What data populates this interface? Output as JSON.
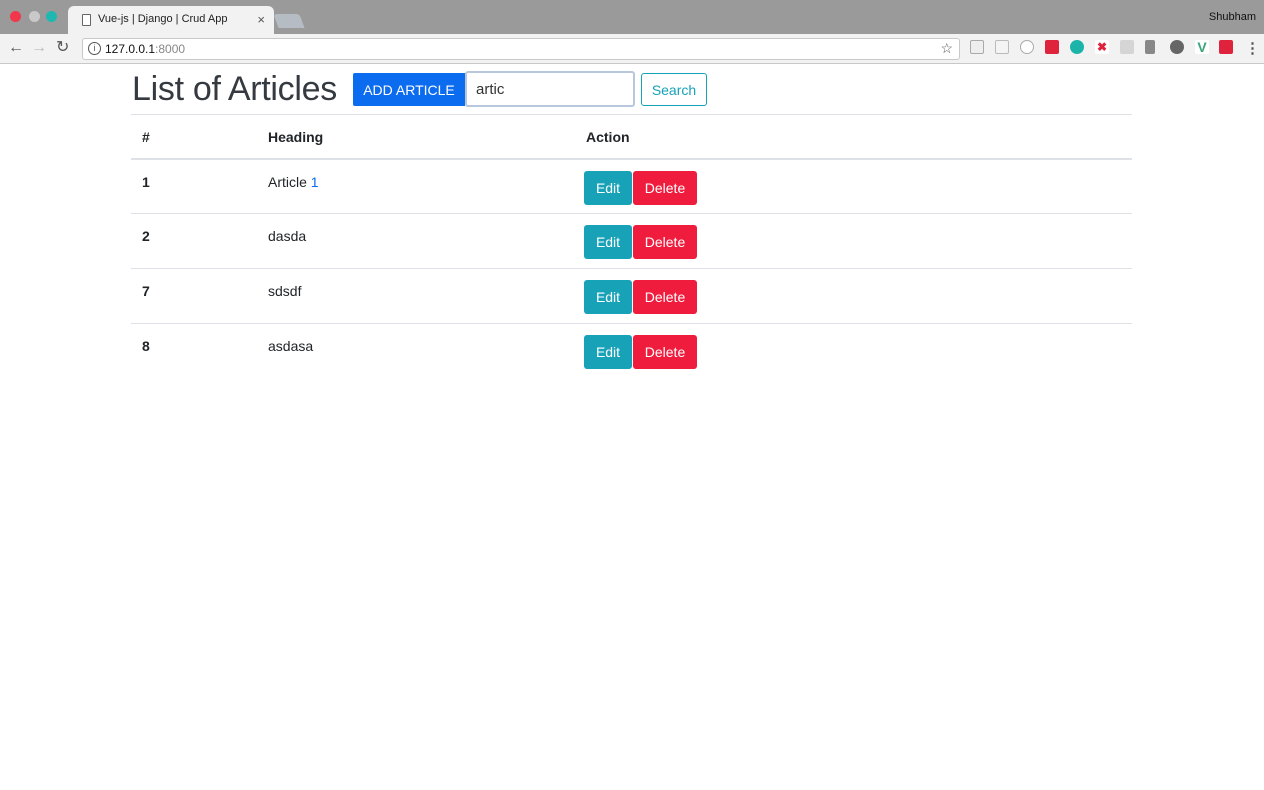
{
  "browser": {
    "tab_title": "Vue-js | Django | Crud App",
    "profile_name": "Shubham",
    "url_host": "127.0.0.1",
    "url_port": ":8000"
  },
  "page": {
    "title": "List of Articles",
    "add_button_label": "ADD ARTICLE",
    "search_value": "artic",
    "search_button_label": "Search"
  },
  "table": {
    "headers": {
      "id": "#",
      "heading": "Heading",
      "action": "Action"
    },
    "rows": [
      {
        "id": "1",
        "heading_text": "Article ",
        "heading_suffix": "1",
        "edit_label": "Edit",
        "delete_label": "Delete"
      },
      {
        "id": "2",
        "heading_text": "dasda",
        "heading_suffix": "",
        "edit_label": "Edit",
        "delete_label": "Delete"
      },
      {
        "id": "7",
        "heading_text": "sdsdf",
        "heading_suffix": "",
        "edit_label": "Edit",
        "delete_label": "Delete"
      },
      {
        "id": "8",
        "heading_text": "asdasa",
        "heading_suffix": "",
        "edit_label": "Edit",
        "delete_label": "Delete"
      }
    ]
  },
  "colors": {
    "primary": "#0b6cf0",
    "info": "#17a2b8",
    "danger": "#ef1c3e",
    "title": "#343a40"
  }
}
